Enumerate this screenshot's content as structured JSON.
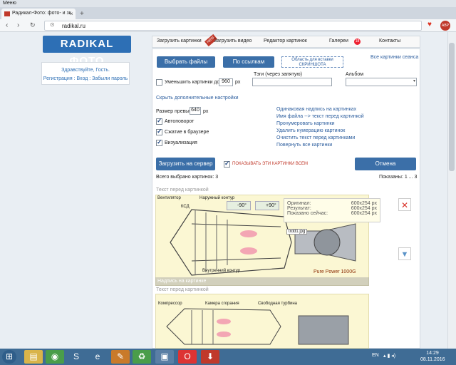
{
  "browser": {
    "menu": "Меню",
    "tab_title": "Радикал-Фото: фото- и зк",
    "url": "radikal.ru"
  },
  "nav": {
    "upload_pics": "Загрузить картинки",
    "upload_video": "Загрузить видео",
    "editor": "Редактор картинок",
    "gallery": "Галереи",
    "contacts": "Контакты",
    "new_badge": "NEW"
  },
  "sidebar": {
    "logo": "RADIKAL ФОТО",
    "greeting": "Здравствуйте, Гость.",
    "links": "Регистрация : Вход : Забыли пароль"
  },
  "upload": {
    "choose_files": "Выбрать файлы",
    "by_links": "По ссылкам",
    "paste_area": "Область для вставки СКРИНШОТА",
    "all_session": "Все картинки сеанса",
    "reduce_label": "Уменьшить картинки до",
    "reduce_value": "960",
    "px": "px",
    "tags_label": "Тэги (через запятую)",
    "album_label": "Альбом",
    "hide_settings": "Скрыть дополнительные настройки",
    "preview_label": "Размер превью",
    "preview_value": "640",
    "autorotate": "Автоповорот",
    "compress": "Сжатие в браузере",
    "visualize": "Визуализация",
    "opt1": "Одинаковая надпись на картинках",
    "opt2": "Имя файла --> текст перед картинкой",
    "opt3": "Пронумеровать картинки",
    "opt4": "Удалить нумерацию картинок",
    "opt5": "Очистить текст перед картинками",
    "opt6": "Повернуть все картинки",
    "upload_server": "Загрузить на сервер",
    "show_all": "ПОКАЗЫВАТЬ ЭТИ КАРТИНКИ ВСЕМ",
    "cancel": "Отмена",
    "total_selected": "Всего выбрано картинок: 3",
    "shown": "Показаны: 1 ... 3"
  },
  "image1": {
    "text_before": "Текст перед картинкой",
    "rot_left": "-90°",
    "rot_right": "+90°",
    "orig_label": "Оригинал:",
    "orig_val": "600x254 px",
    "res_label": "Результат:",
    "res_val": "600x254 px",
    "now_label": "Показано сейчас:",
    "now_val": "600x254 px",
    "filename": "trdd1.jpg",
    "caption": "Надпись на картинке",
    "engine": "Pure Power 1000G",
    "lbl_fan": "Вентилятор",
    "lbl_lpc": "КСД",
    "lbl_outer": "Наружный контур",
    "lbl_inner": "Внутренний контур"
  },
  "image2": {
    "text_before": "Текст перед картинкой",
    "lbl_comp": "Компрессор",
    "lbl_cc": "Камера сгорания",
    "lbl_turb": "Свободная турбина"
  },
  "taskbar": {
    "lang": "EN",
    "time": "14:29",
    "date": "08.11.2016"
  },
  "colors": {
    "accent": "#3b6fa8",
    "delete": "#d9342b"
  }
}
